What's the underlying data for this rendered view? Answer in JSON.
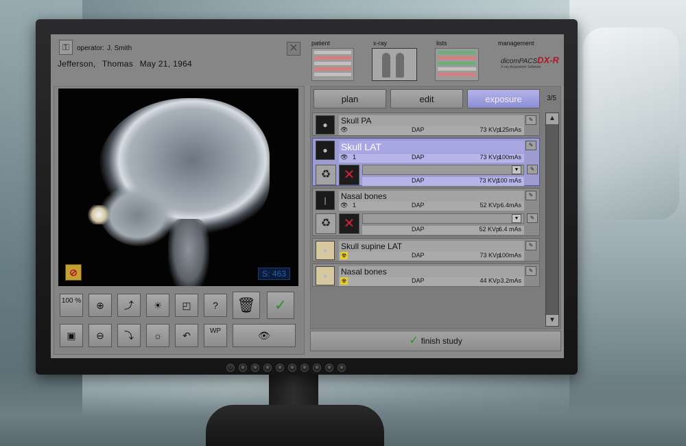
{
  "operator": {
    "label": "operator:",
    "name": "J. Smith"
  },
  "patient": {
    "last_name": "Jefferson,",
    "first_name": "Thomas",
    "dob": "May 21, 1964"
  },
  "nav_tabs": [
    {
      "label": "patient"
    },
    {
      "label": "x-ray"
    },
    {
      "label": "lists"
    },
    {
      "label": "management"
    }
  ],
  "brand": {
    "name_a": "dicomPACS",
    "name_b": "DX-R",
    "tagline": "X-ray Acquisition Software"
  },
  "image_viewer": {
    "counter": "S: 463"
  },
  "toolbar": {
    "zoom_100": "100 %",
    "wp": "WP"
  },
  "phase_tabs": [
    {
      "label": "plan"
    },
    {
      "label": "edit"
    },
    {
      "label": "exposure"
    }
  ],
  "page_count": "3/5",
  "exams": [
    {
      "name": "Skull PA",
      "dap": "DAP",
      "kvp": "73 KVp",
      "mas": "125mAs"
    },
    {
      "name": "Skull LAT",
      "count": "1",
      "dap": "DAP",
      "kvp": "73 KVp",
      "mas": "100mAs",
      "sub_dap": "DAP",
      "sub_kvp": "73 KVp",
      "sub_mas": "100 mAs"
    },
    {
      "name": "Nasal bones",
      "count": "1",
      "dap": "DAP",
      "kvp": "52 KVp",
      "mas": "6.4mAs",
      "sub_dap": "DAP",
      "sub_kvp": "52 KVp",
      "sub_mas": "6.4 mAs"
    },
    {
      "name": "Skull supine LAT",
      "dap": "DAP",
      "kvp": "73 KVp",
      "mas": "100mAs"
    },
    {
      "name": "Nasal bones",
      "dap": "DAP",
      "kvp": "44 KVp",
      "mas": "3.2mAs"
    }
  ],
  "finish_study": "finish study",
  "colors": {
    "accent": "#8d8dd6",
    "selected_row": "#9c9cd0",
    "brand_red": "#b0172a"
  }
}
